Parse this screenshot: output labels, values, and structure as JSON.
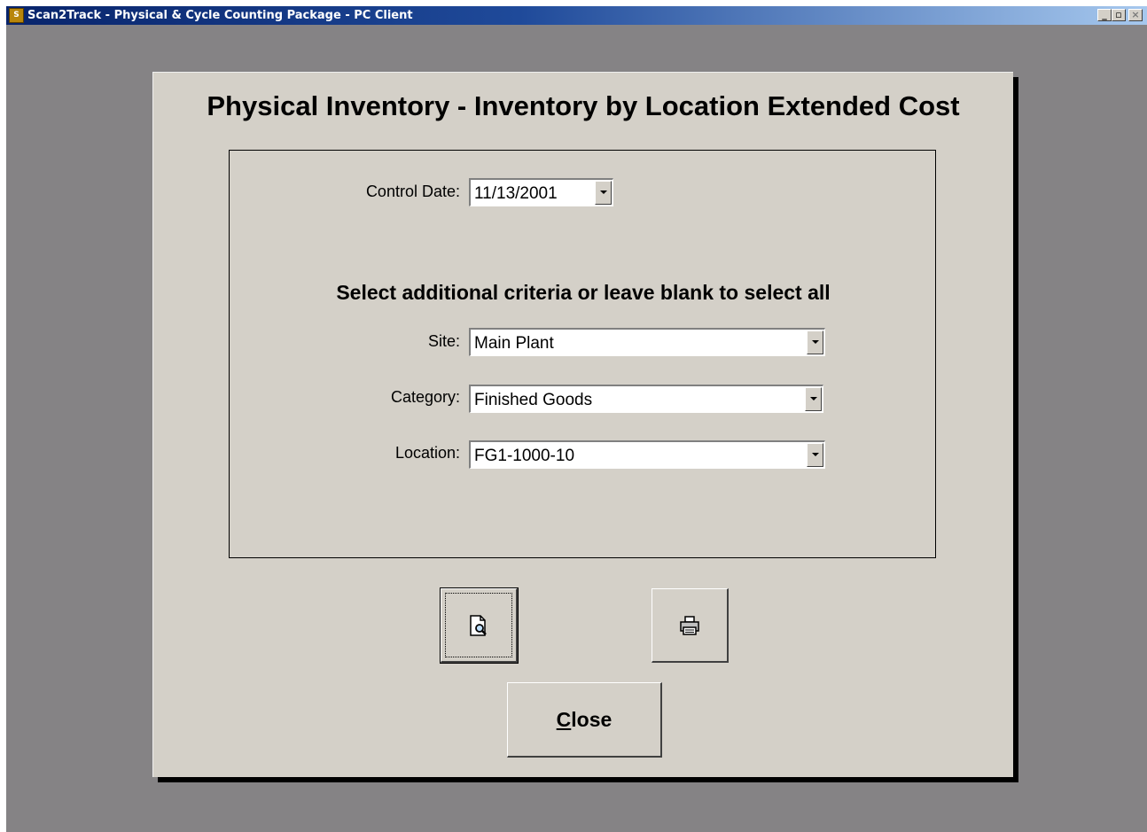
{
  "window": {
    "title": "Scan2Track - Physical & Cycle Counting Package - PC Client",
    "minimize_glyph": "_",
    "restore_glyph": "▫",
    "close_glyph": "×"
  },
  "form": {
    "title": "Physical Inventory - Inventory by Location Extended Cost",
    "control_date": {
      "label": "Control Date:",
      "value": "11/13/2001"
    },
    "criteria_heading": "Select additional criteria or leave blank to select all",
    "site": {
      "label": "Site:",
      "value": "Main Plant"
    },
    "category": {
      "label": "Category:",
      "value": "Finished Goods"
    },
    "location": {
      "label": "Location:",
      "value": "FG1-1000-10"
    }
  },
  "buttons": {
    "preview_icon": "print-preview-icon",
    "print_icon": "printer-icon",
    "close_prefix": "C",
    "close_rest": "lose"
  }
}
